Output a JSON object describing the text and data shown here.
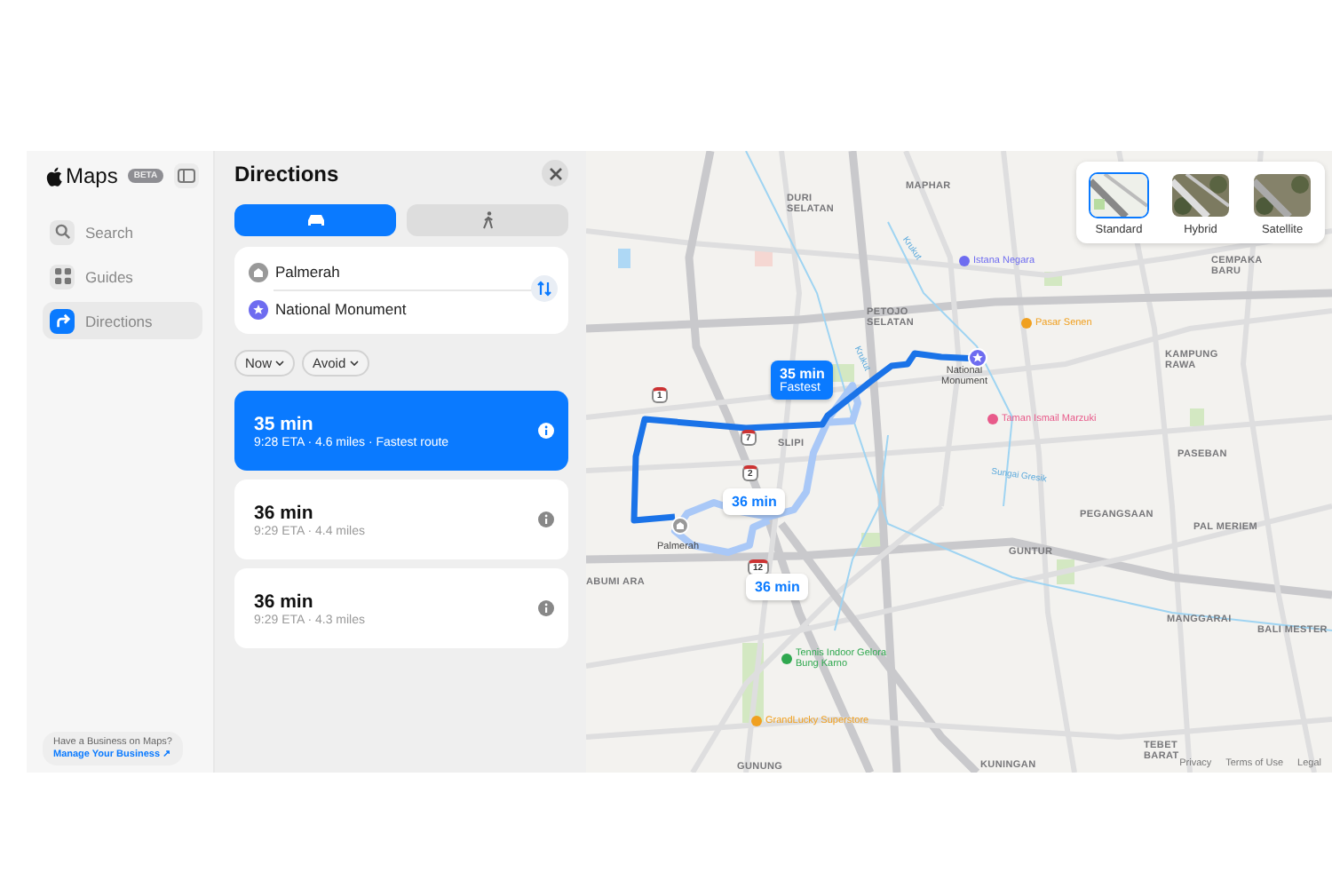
{
  "sidebar": {
    "app_name": "Maps",
    "badge": "BETA",
    "items": [
      {
        "label": "Search",
        "selected": false
      },
      {
        "label": "Guides",
        "selected": false
      },
      {
        "label": "Directions",
        "selected": true
      }
    ],
    "business": {
      "prompt": "Have a Business on Maps?",
      "link": "Manage Your Business ↗"
    }
  },
  "directions": {
    "title": "Directions",
    "modes": [
      {
        "kind": "car",
        "selected": true
      },
      {
        "kind": "walk",
        "selected": false
      }
    ],
    "from": "Palmerah",
    "to": "National Monument",
    "options": [
      "Now",
      "Avoid"
    ],
    "routes": [
      {
        "time": "35 min",
        "detail": "9:28 ETA · 4.6 miles · Fastest route",
        "selected": true
      },
      {
        "time": "36 min",
        "detail": "9:29 ETA · 4.4 miles",
        "selected": false
      },
      {
        "time": "36 min",
        "detail": "9:29 ETA · 4.3 miles",
        "selected": false
      }
    ]
  },
  "map": {
    "map_types": [
      {
        "label": "Standard",
        "selected": true
      },
      {
        "label": "Hybrid",
        "selected": false
      },
      {
        "label": "Satellite",
        "selected": false
      }
    ],
    "labels": [
      {
        "text": "DURI SELATAN",
        "kind": "district"
      },
      {
        "text": "MAPHAR",
        "kind": "district"
      },
      {
        "text": "Istana Negara",
        "kind": "poi",
        "color": "#6e6cf0"
      },
      {
        "text": "CEMPAKA BARU",
        "kind": "district"
      },
      {
        "text": "PETOJO SELATAN",
        "kind": "district"
      },
      {
        "text": "Pasar Senen",
        "kind": "poi",
        "color": "#f0a020"
      },
      {
        "text": "KAMPUNG RAWA",
        "kind": "district"
      },
      {
        "text": "National Monument",
        "kind": "landmark"
      },
      {
        "text": "Taman Ismail Marzuki",
        "kind": "poi",
        "color": "#e85a8a"
      },
      {
        "text": "SLIPI",
        "kind": "district"
      },
      {
        "text": "PASEBAN",
        "kind": "district"
      },
      {
        "text": "Palmerah",
        "kind": "landmark"
      },
      {
        "text": "ABUMI ARA",
        "kind": "district"
      },
      {
        "text": "Krukut",
        "kind": "water"
      },
      {
        "text": "Krukut",
        "kind": "water"
      },
      {
        "text": "Sungai Gresik",
        "kind": "water"
      },
      {
        "text": "PEGANGSAAN",
        "kind": "district"
      },
      {
        "text": "PAL MERIEM",
        "kind": "district"
      },
      {
        "text": "GUNTUR",
        "kind": "district"
      },
      {
        "text": "MANGGARAI",
        "kind": "district"
      },
      {
        "text": "BALI MESTER",
        "kind": "district"
      },
      {
        "text": "Tennis Indoor Gelora Bung Karno",
        "kind": "poi",
        "color": "#2fa84f"
      },
      {
        "text": "GrandLucky Superstore",
        "kind": "poi",
        "color": "#f0a020"
      },
      {
        "text": "TEBET BARAT",
        "kind": "district"
      },
      {
        "text": "KUNINGAN",
        "kind": "district"
      },
      {
        "text": "GUNUNG",
        "kind": "district"
      }
    ],
    "shields": [
      "1",
      "7",
      "2",
      "12"
    ],
    "route_bubbles": [
      {
        "time": "35 min",
        "note": "Fastest",
        "selected": true
      },
      {
        "time": "36 min",
        "selected": false
      },
      {
        "time": "36 min",
        "selected": false
      }
    ],
    "footer_links": [
      "Privacy",
      "Terms of Use",
      "Legal"
    ]
  }
}
